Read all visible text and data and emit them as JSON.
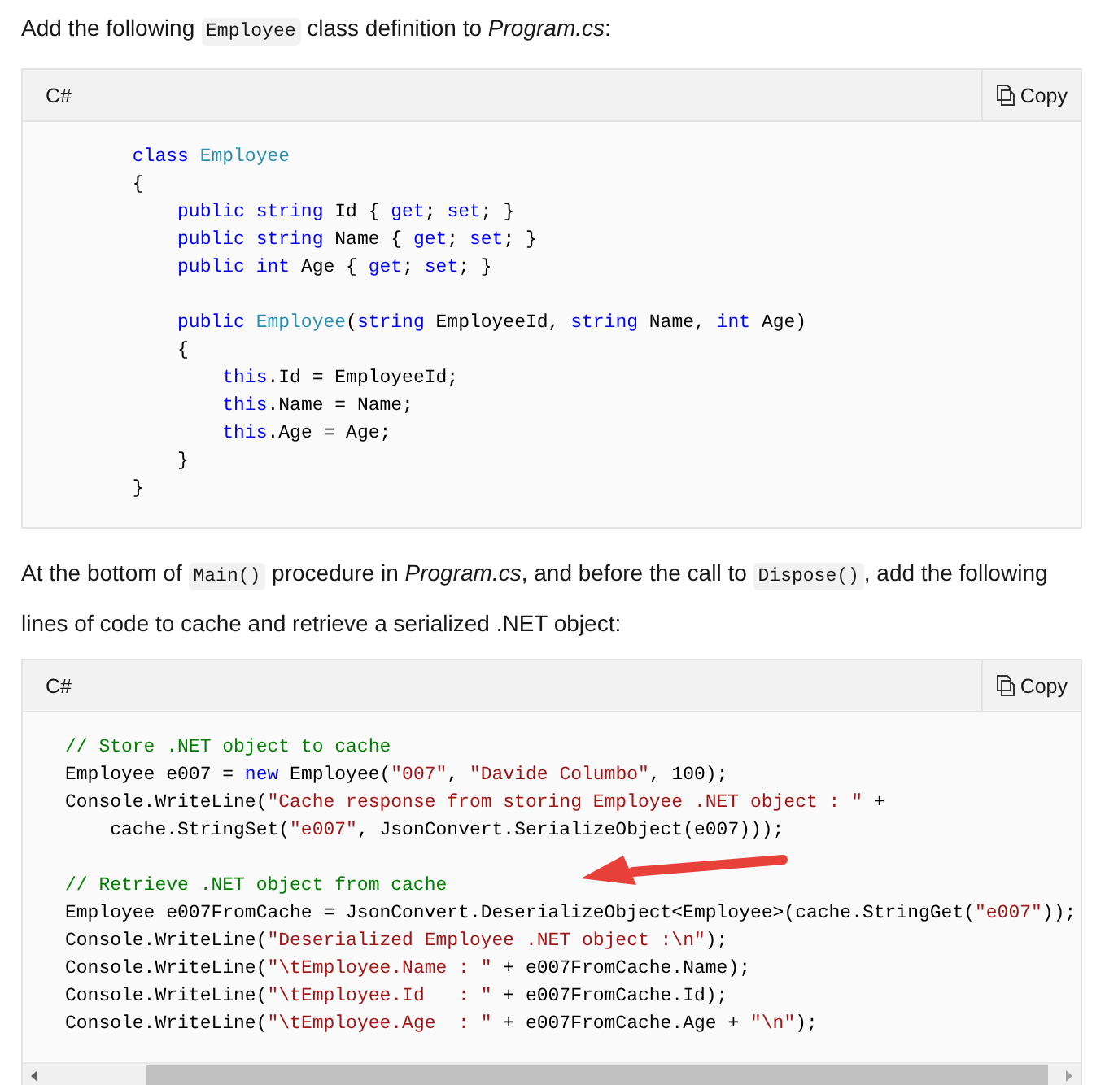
{
  "content": [
    {
      "kind": "paragraph",
      "runs": [
        {
          "kind": "text",
          "text": "Add the following "
        },
        {
          "kind": "code",
          "text": "Employee"
        },
        {
          "kind": "text",
          "text": " class definition to *Program.cs*:"
        }
      ]
    },
    {
      "kind": "code_block",
      "language": "C#",
      "copy_label": "Copy",
      "scrollbar": false,
      "groups": [
        [
          [
            {
              "kind": "keyword",
              "text": "      class "
            },
            {
              "kind": "type",
              "text": "Employee"
            }
          ],
          [
            {
              "kind": "plain",
              "text": "      {"
            }
          ],
          [
            {
              "kind": "keyword",
              "text": "          public string "
            },
            {
              "kind": "plain",
              "text": "Id { "
            },
            {
              "kind": "keyword",
              "text": "get"
            },
            {
              "kind": "plain",
              "text": "; "
            },
            {
              "kind": "keyword",
              "text": "set"
            },
            {
              "kind": "plain",
              "text": "; }"
            }
          ],
          [
            {
              "kind": "keyword",
              "text": "          public string "
            },
            {
              "kind": "plain",
              "text": "Name { "
            },
            {
              "kind": "keyword",
              "text": "get"
            },
            {
              "kind": "plain",
              "text": "; "
            },
            {
              "kind": "keyword",
              "text": "set"
            },
            {
              "kind": "plain",
              "text": "; }"
            }
          ],
          [
            {
              "kind": "keyword",
              "text": "          public int "
            },
            {
              "kind": "plain",
              "text": "Age { "
            },
            {
              "kind": "keyword",
              "text": "get"
            },
            {
              "kind": "plain",
              "text": "; "
            },
            {
              "kind": "keyword",
              "text": "set"
            },
            {
              "kind": "plain",
              "text": "; }"
            }
          ]
        ],
        [
          [
            {
              "kind": "keyword",
              "text": "          public "
            },
            {
              "kind": "type",
              "text": "Employee"
            },
            {
              "kind": "plain",
              "text": "("
            },
            {
              "kind": "keyword",
              "text": "string "
            },
            {
              "kind": "plain",
              "text": "EmployeeId, "
            },
            {
              "kind": "keyword",
              "text": "string "
            },
            {
              "kind": "plain",
              "text": "Name, "
            },
            {
              "kind": "keyword",
              "text": "int "
            },
            {
              "kind": "plain",
              "text": "Age)"
            }
          ],
          [
            {
              "kind": "plain",
              "text": "          {"
            }
          ],
          [
            {
              "kind": "keyword",
              "text": "              this"
            },
            {
              "kind": "plain",
              "text": ".Id = EmployeeId;"
            }
          ],
          [
            {
              "kind": "keyword",
              "text": "              this"
            },
            {
              "kind": "plain",
              "text": ".Name = Name;"
            }
          ],
          [
            {
              "kind": "keyword",
              "text": "              this"
            },
            {
              "kind": "plain",
              "text": ".Age = Age;"
            }
          ],
          [
            {
              "kind": "plain",
              "text": "          }"
            }
          ],
          [
            {
              "kind": "plain",
              "text": "      }"
            }
          ]
        ]
      ]
    },
    {
      "kind": "paragraph",
      "runs": [
        {
          "kind": "text",
          "text": "At the bottom of "
        },
        {
          "kind": "code",
          "text": "Main()"
        },
        {
          "kind": "text",
          "text": " procedure in *Program.cs*, and before the call to "
        },
        {
          "kind": "code",
          "text": "Dispose()"
        },
        {
          "kind": "text",
          "text": ", add the following lines of code to cache and retrieve a serialized .NET object:"
        }
      ]
    },
    {
      "kind": "code_block",
      "language": "C#",
      "copy_label": "Copy",
      "scrollbar": true,
      "groups": [
        [
          [
            {
              "kind": "comment",
              "text": "// Store .NET object to cache"
            }
          ],
          [
            {
              "kind": "plain",
              "text": "Employee e007 = "
            },
            {
              "kind": "keyword",
              "text": "new"
            },
            {
              "kind": "plain",
              "text": " Employee("
            },
            {
              "kind": "string",
              "text": "\"007\""
            },
            {
              "kind": "plain",
              "text": ", "
            },
            {
              "kind": "string",
              "text": "\"Davide Columbo\""
            },
            {
              "kind": "plain",
              "text": ", 100);"
            }
          ],
          [
            {
              "kind": "plain",
              "text": "Console.WriteLine("
            },
            {
              "kind": "string",
              "text": "\"Cache response from storing Employee .NET object : \""
            },
            {
              "kind": "plain",
              "text": " +"
            }
          ],
          [
            {
              "kind": "plain",
              "text": "    cache.StringSet("
            },
            {
              "kind": "string",
              "text": "\"e007\""
            },
            {
              "kind": "plain",
              "text": ", JsonConvert.SerializeObject(e007)));"
            }
          ]
        ],
        [
          [
            {
              "kind": "comment",
              "text": "// Retrieve .NET object from cache"
            }
          ],
          [
            {
              "kind": "plain",
              "text": "Employee e007FromCache = JsonConvert.DeserializeObject<Employee>(cache.StringGet("
            },
            {
              "kind": "string",
              "text": "\"e007\""
            },
            {
              "kind": "plain",
              "text": "));"
            }
          ],
          [
            {
              "kind": "plain",
              "text": "Console.WriteLine("
            },
            {
              "kind": "string",
              "text": "\"Deserialized Employee .NET object :\\n\""
            },
            {
              "kind": "plain",
              "text": ");"
            }
          ],
          [
            {
              "kind": "plain",
              "text": "Console.WriteLine("
            },
            {
              "kind": "string",
              "text": "\"\\tEmployee.Name : \""
            },
            {
              "kind": "plain",
              "text": " + e007FromCache.Name);"
            }
          ],
          [
            {
              "kind": "plain",
              "text": "Console.WriteLine("
            },
            {
              "kind": "string",
              "text": "\"\\tEmployee.Id   : \""
            },
            {
              "kind": "plain",
              "text": " + e007FromCache.Id);"
            }
          ],
          [
            {
              "kind": "plain",
              "text": "Console.WriteLine("
            },
            {
              "kind": "string",
              "text": "\"\\tEmployee.Age  : \""
            },
            {
              "kind": "plain",
              "text": " + e007FromCache.Age + "
            },
            {
              "kind": "string",
              "text": "\"\\n\""
            },
            {
              "kind": "plain",
              "text": ");"
            }
          ]
        ]
      ]
    }
  ],
  "annotations": [
    {
      "kind": "arrow"
    }
  ]
}
